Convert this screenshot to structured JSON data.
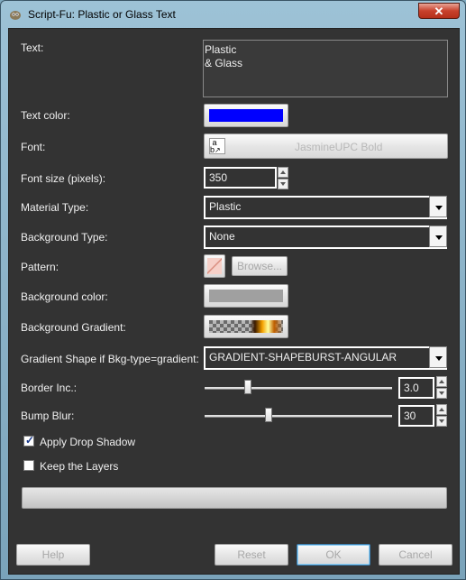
{
  "window": {
    "title": "Script-Fu: Plastic or Glass Text",
    "close_label": "✕"
  },
  "form": {
    "text": {
      "label": "Text:",
      "line1": "Plastic",
      "line2": "& Glass"
    },
    "text_color": {
      "label": "Text color:",
      "color": "#0000ff"
    },
    "font": {
      "label": "Font:",
      "value": "JasmineUPC Bold"
    },
    "font_size": {
      "label": "Font size (pixels):",
      "value": "350"
    },
    "material_type": {
      "label": "Material Type:",
      "value": "Plastic"
    },
    "background_type": {
      "label": "Background Type:",
      "value": "None"
    },
    "pattern": {
      "label": "Pattern:",
      "browse_label": "Browse..."
    },
    "background_color": {
      "label": "Background color:",
      "color": "#a0a0a0"
    },
    "background_gradient": {
      "label": "Background Gradient:"
    },
    "gradient_shape": {
      "label": "Gradient Shape if Bkg-type=gradient:",
      "value": "GRADIENT-SHAPEBURST-ANGULAR"
    },
    "border_inc": {
      "label": "Border Inc.:",
      "value": "3.0",
      "level": 0.22
    },
    "bump_blur": {
      "label": "Bump Blur:",
      "value": "30",
      "level": 0.34
    },
    "apply_drop_shadow": {
      "label": "Apply Drop Shadow",
      "checked": true
    },
    "keep_layers": {
      "label": "Keep the Layers",
      "checked": false
    }
  },
  "buttons": {
    "help": "Help",
    "reset": "Reset",
    "ok": "OK",
    "cancel": "Cancel"
  }
}
